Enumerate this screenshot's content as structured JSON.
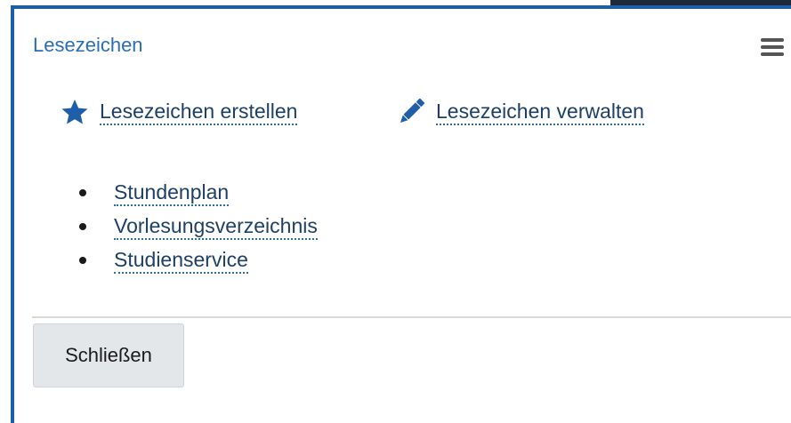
{
  "panel": {
    "title": "Lesezeichen",
    "menu_icon": "hamburger-menu-icon"
  },
  "actions": {
    "create": {
      "label": "Lesezeichen erstellen",
      "icon": "star-icon"
    },
    "manage": {
      "label": "Lesezeichen verwalten",
      "icon": "pencil-icon"
    }
  },
  "bookmarks": [
    {
      "label": "Stundenplan"
    },
    {
      "label": "Vorlesungsverzeichnis"
    },
    {
      "label": "Studienservice"
    }
  ],
  "footer": {
    "close_label": "Schließen"
  },
  "colors": {
    "accent": "#1f5ea8",
    "title": "#2a6db5",
    "link": "#1e3f66",
    "icon": "#1f5ea8"
  }
}
